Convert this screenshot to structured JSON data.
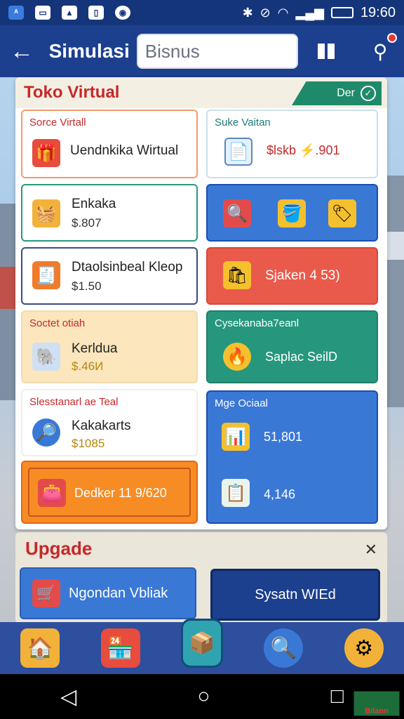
{
  "status_bar": {
    "time": "19:60",
    "left_icons": [
      "app-icon",
      "message-icon",
      "image-icon",
      "phone-icon",
      "record-icon"
    ]
  },
  "app_bar": {
    "title": "Simulasi",
    "search_value": "Bisnus"
  },
  "panel": {
    "title": "Toko Virtual",
    "done_label": "Der"
  },
  "cards": {
    "c1": {
      "title": "Sorce Virtall",
      "name": "Uendnkika Wirtual"
    },
    "c2": {
      "title": "Suke Vaitan",
      "price": "$lskb ⚡.901"
    },
    "c3": {
      "name": "Enkaka",
      "price": "$.807"
    },
    "c5": {
      "name": "Dtaolsinbeal Kleop",
      "price": "$1.50"
    },
    "c6": {
      "label": "Sjaken 4 53)"
    },
    "c7": {
      "title": "Soctet otiah",
      "name": "Kerldua",
      "price": "$.46И"
    },
    "c8": {
      "title": "Cysekanaba7eanl",
      "label": "Saplac SeilD"
    },
    "c9": {
      "title": "Slesstanarl ae Teal",
      "name": "Kakakarts",
      "price": "$1085"
    },
    "c10": {
      "title": "Mge Ociaal",
      "price_a": "51,801",
      "price_b": "4,146"
    },
    "c11": {
      "label": "Dedker 11 9/620"
    }
  },
  "upgrade": {
    "title": "Upgade",
    "btn_left": "Ngondan Vbliak",
    "btn_right": "Sysatn WIEd"
  },
  "watermark": "Bilann",
  "colors": {
    "blue_dark": "#1c3f8e",
    "accent_red": "#c62828",
    "card_blue": "#3a78d6",
    "card_red": "#ea5a4b",
    "card_green": "#26977c",
    "card_orange": "#f78c25"
  }
}
